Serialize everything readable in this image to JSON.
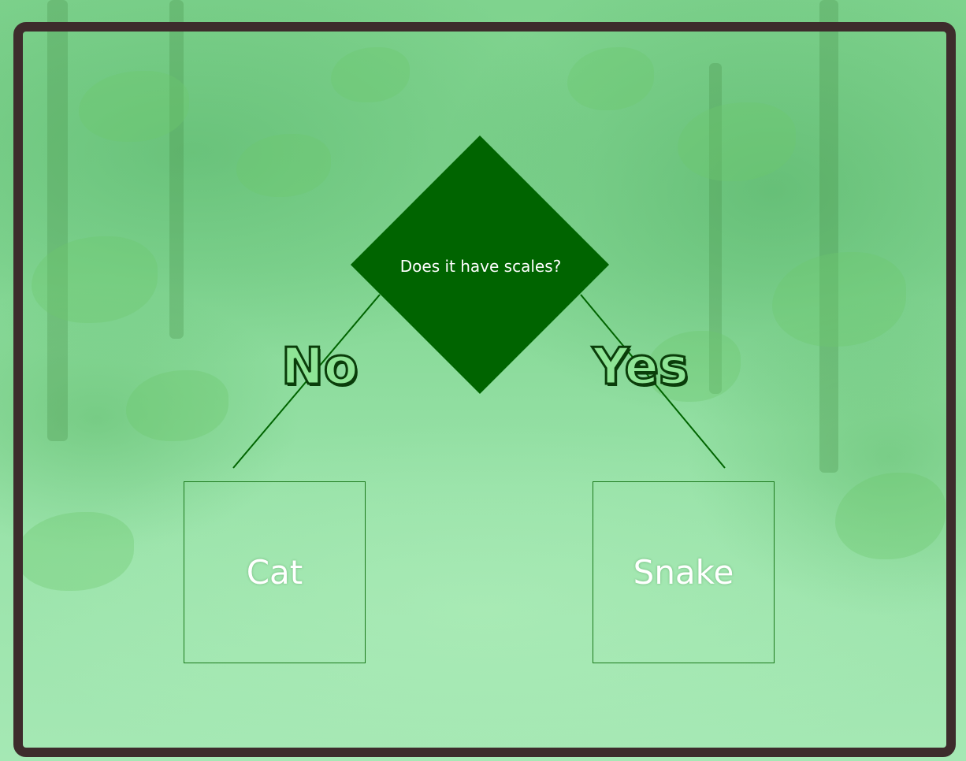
{
  "decision": {
    "question": "Does it have scales?"
  },
  "branches": {
    "no_label": "No",
    "yes_label": "Yes"
  },
  "answers": {
    "no_answer": "Cat",
    "yes_answer": "Snake"
  },
  "colors": {
    "diamond_fill": "#006400",
    "frame_border": "#3d2c2c",
    "branch_label_fill": "#8fe596",
    "box_border": "#1c7a1c",
    "connector": "#006400"
  }
}
